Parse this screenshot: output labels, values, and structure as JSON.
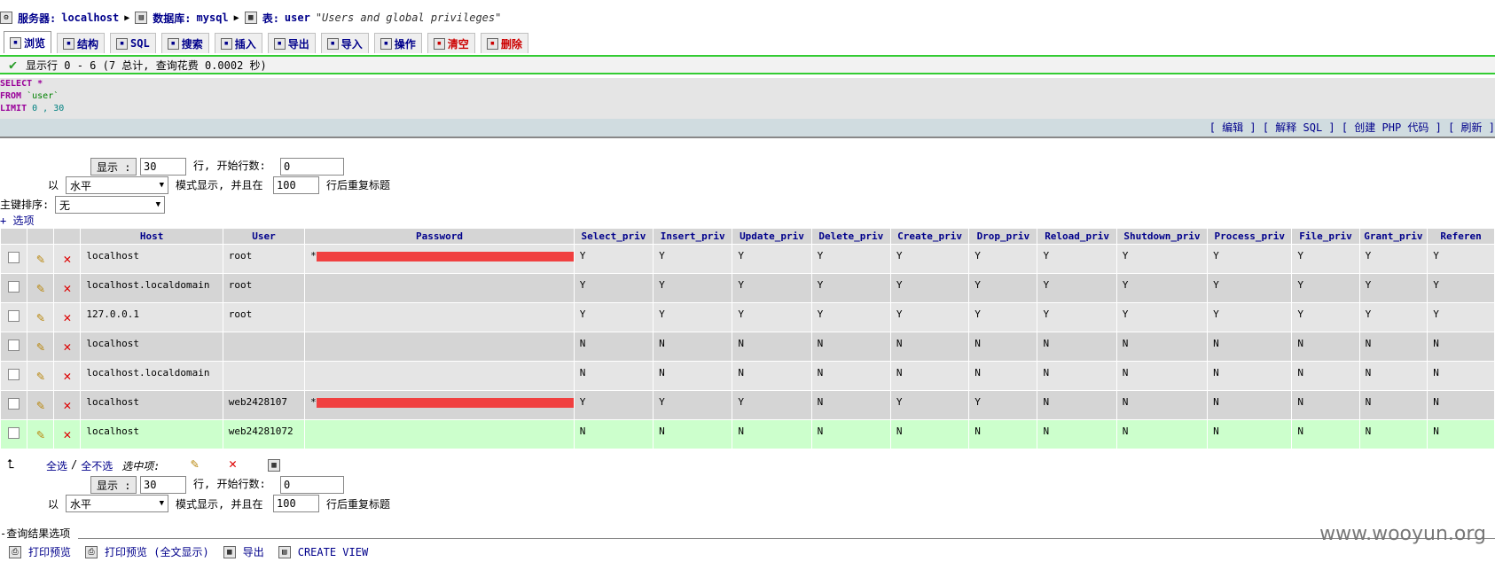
{
  "breadcrumb": {
    "server_label": "服务器:",
    "server": "localhost",
    "db_label": "数据库:",
    "db": "mysql",
    "table_label": "表:",
    "table": "user",
    "comment": "\"Users and global privileges\""
  },
  "tabs": [
    {
      "label": "浏览",
      "icon": "browse-icon"
    },
    {
      "label": "结构",
      "icon": "structure-icon"
    },
    {
      "label": "SQL",
      "icon": "sql-icon"
    },
    {
      "label": "搜索",
      "icon": "search-icon"
    },
    {
      "label": "插入",
      "icon": "insert-icon"
    },
    {
      "label": "导出",
      "icon": "export-icon"
    },
    {
      "label": "导入",
      "icon": "import-icon"
    },
    {
      "label": "操作",
      "icon": "operations-icon"
    },
    {
      "label": "清空",
      "icon": "empty-icon"
    },
    {
      "label": "删除",
      "icon": "drop-icon"
    }
  ],
  "status": {
    "message": "显示行 0 - 6 (7 总计, 查询花费 0.0002 秒)",
    "color": "#33cc33"
  },
  "sql": {
    "select": "SELECT",
    "star": "*",
    "from": "FROM",
    "table": "`user`",
    "limit": "LIMIT",
    "limit_val": "0 , 30"
  },
  "sql_links": "[ 编辑 ] [ 解释 SQL ] [ 创建 PHP 代码 ] [ 刷新 ]",
  "nav_top": {
    "show_button": "显示 :",
    "rows_value": "30",
    "rows_text": "行, 开始行数:",
    "start_value": "0",
    "mode_prefix": "以",
    "mode_value": "水平",
    "mode_text": "模式显示, 并且在",
    "repeat_value": "100",
    "repeat_text": "行后重复标题",
    "sort_label": "主键排序:",
    "sort_value": "无",
    "options_link": "+ 选项"
  },
  "columns": [
    "Host",
    "User",
    "Password",
    "Select_priv",
    "Insert_priv",
    "Update_priv",
    "Delete_priv",
    "Create_priv",
    "Drop_priv",
    "Reload_priv",
    "Shutdown_priv",
    "Process_priv",
    "File_priv",
    "Grant_priv",
    "Referen"
  ],
  "rows": [
    {
      "host": "localhost",
      "user": "root",
      "pw_prefix": "*",
      "redacted": true,
      "privs": [
        "Y",
        "Y",
        "Y",
        "Y",
        "Y",
        "Y",
        "Y",
        "Y",
        "Y",
        "Y",
        "Y",
        "Y"
      ]
    },
    {
      "host": "localhost.localdomain",
      "user": "root",
      "pw_prefix": "",
      "redacted": false,
      "privs": [
        "Y",
        "Y",
        "Y",
        "Y",
        "Y",
        "Y",
        "Y",
        "Y",
        "Y",
        "Y",
        "Y",
        "Y"
      ]
    },
    {
      "host": "127.0.0.1",
      "user": "root",
      "pw_prefix": "",
      "redacted": false,
      "privs": [
        "Y",
        "Y",
        "Y",
        "Y",
        "Y",
        "Y",
        "Y",
        "Y",
        "Y",
        "Y",
        "Y",
        "Y"
      ]
    },
    {
      "host": "localhost",
      "user": "",
      "pw_prefix": "",
      "redacted": false,
      "privs": [
        "N",
        "N",
        "N",
        "N",
        "N",
        "N",
        "N",
        "N",
        "N",
        "N",
        "N",
        "N"
      ]
    },
    {
      "host": "localhost.localdomain",
      "user": "",
      "pw_prefix": "",
      "redacted": false,
      "privs": [
        "N",
        "N",
        "N",
        "N",
        "N",
        "N",
        "N",
        "N",
        "N",
        "N",
        "N",
        "N"
      ]
    },
    {
      "host": "localhost",
      "user": "web2428107",
      "pw_prefix": "*",
      "redacted": true,
      "privs": [
        "Y",
        "Y",
        "Y",
        "N",
        "Y",
        "Y",
        "N",
        "N",
        "N",
        "N",
        "N",
        "N"
      ]
    },
    {
      "host": "localhost",
      "user": "web24281072",
      "pw_prefix": "",
      "redacted": false,
      "privs": [
        "N",
        "N",
        "N",
        "N",
        "N",
        "N",
        "N",
        "N",
        "N",
        "N",
        "N",
        "N"
      ]
    }
  ],
  "selection": {
    "check_all": "全选",
    "separator": "/",
    "uncheck_all": "全不选",
    "with_selected": "选中项:"
  },
  "nav_bottom": {
    "show_button": "显示 :",
    "rows_value": "30",
    "rows_text": "行, 开始行数:",
    "start_value": "0",
    "mode_prefix": "以",
    "mode_value": "水平",
    "mode_text": "模式显示, 并且在",
    "repeat_value": "100",
    "repeat_text": "行后重复标题"
  },
  "result_ops": {
    "legend": "查询结果选项",
    "print_view": "打印预览",
    "print_view_full": "打印预览 (全文显示)",
    "export": "导出",
    "create_view": "CREATE VIEW"
  },
  "watermark": "www.wooyun.org"
}
